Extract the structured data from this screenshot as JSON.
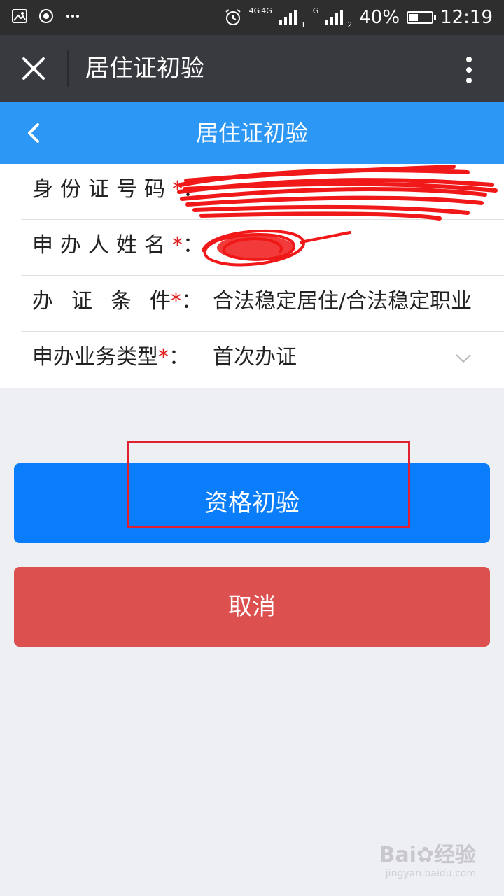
{
  "status_bar": {
    "network_1": "4G",
    "network_2": "4G",
    "network_3": "G",
    "sim_1": "1",
    "sim_2": "2",
    "battery": "40%",
    "battery_level": 0.4,
    "time": "12:19",
    "icons": [
      "image-icon",
      "record-icon",
      "more-dots-icon",
      "alarm-icon",
      "signal-icon",
      "battery-icon"
    ]
  },
  "wx_bar": {
    "title": "居住证初验",
    "icons": [
      "close-icon",
      "more-vertical-icon"
    ]
  },
  "header": {
    "title": "居住证初验",
    "icons": [
      "back-icon"
    ]
  },
  "form": {
    "id_number_label": "身份证号码",
    "name_label": "申办人姓名",
    "condition_label": "办证条件",
    "condition_value": "合法稳定居住/合法稳定职业",
    "type_label": "申办业务类型",
    "type_value": "首次办证",
    "required_mark": "*",
    "colon": "：",
    "icons": [
      "chevron-down-icon"
    ]
  },
  "buttons": {
    "primary_label": "资格初验",
    "cancel_label": "取消"
  },
  "watermark": {
    "brand": "Bai",
    "brand_tail": "经验",
    "url": "jingyan.baidu.com"
  },
  "colors": {
    "status_bar": "#2e2e2e",
    "wx_bar": "#393a3f",
    "header": "#2d97f5",
    "primary": "#0a7dfa",
    "cancel": "#dc514f",
    "required": "#e02020",
    "annotation": "#e02030"
  }
}
